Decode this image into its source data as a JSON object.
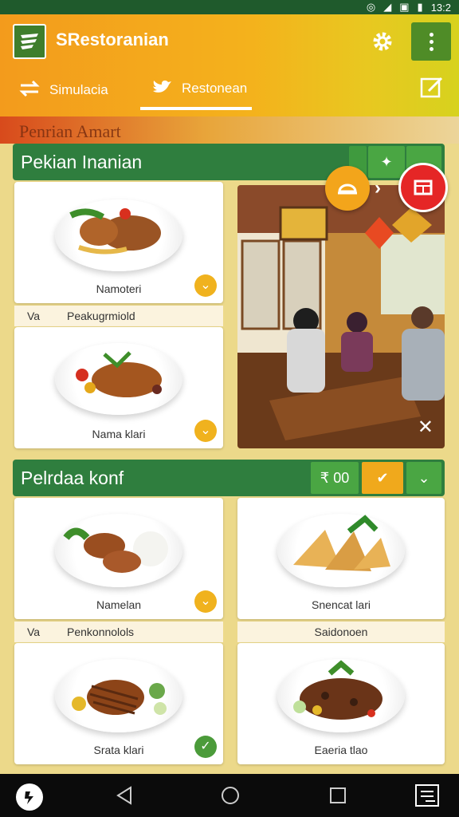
{
  "status_bar": {
    "time": "13:2"
  },
  "app": {
    "title": "SRestoranian"
  },
  "tabs": [
    {
      "label": "Simulacia",
      "icon": "swap-arrows-icon"
    },
    {
      "label": "Restonean",
      "icon": "bird-icon"
    }
  ],
  "banner": {
    "text": "Penrian Amart"
  },
  "section1": {
    "title": "Pekian Inanian",
    "cards": [
      {
        "label": "Namoteri"
      },
      {
        "label": "Nama klari"
      }
    ],
    "row_label": {
      "left": "Va",
      "right": "Peakugrmiold"
    }
  },
  "section2": {
    "title": "Pelrdaa konf",
    "filter_button": {
      "label": "₹ 00"
    },
    "cards": [
      {
        "label": "Namelan"
      },
      {
        "label": "Snencat lari"
      },
      {
        "label": "Srata klari"
      },
      {
        "label": "Eaeria tlao"
      }
    ],
    "row_label_left": {
      "left": "Va",
      "right": "Penkonnolols"
    },
    "row_label_right": {
      "text": "Saidonoen"
    }
  },
  "colors": {
    "green": "#2f7e3e",
    "orange": "#f39b1c",
    "accent_yellow": "#f0b21e",
    "red_fab": "#e52626"
  }
}
